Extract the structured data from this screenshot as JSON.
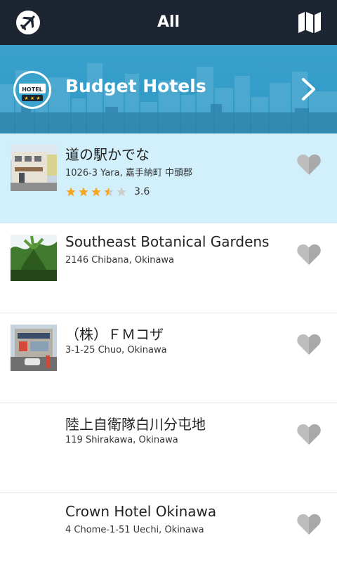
{
  "header": {
    "title": "All",
    "left_icon": "airplane-icon",
    "right_icon": "map-icon",
    "background": "#1d2432"
  },
  "banner": {
    "title": "Budget Hotels",
    "icon": "hotel-icon",
    "icon_text": "HOTEL",
    "chevron_icon": "chevron-right-icon",
    "background": "#3aa2cd"
  },
  "places": [
    {
      "name": "道の駅かでな",
      "address": "1026-3 Yara, 嘉手納町 中頭郡",
      "rating": 3.6,
      "rating_label": "3.6",
      "has_photo": true,
      "selected": true
    },
    {
      "name": "Southeast Botanical Gardens",
      "address": "2146 Chibana, Okinawa",
      "has_photo": true,
      "selected": false
    },
    {
      "name": "（株）ＦＭコザ",
      "address": "3-1-25 Chuo, Okinawa",
      "has_photo": true,
      "selected": false
    },
    {
      "name": "陸上自衛隊白川分屯地",
      "address": "119 Shirakawa, Okinawa",
      "has_photo": false,
      "selected": false
    },
    {
      "name": "Crown Hotel Okinawa",
      "address": "4 Chome-1-51 Uechi, Okinawa",
      "has_photo": false,
      "selected": false
    }
  ],
  "colors": {
    "selected_row": "#d1f0fb",
    "star_filled": "#f5a623",
    "star_empty": "#cccccc",
    "heart": "#bdbdbd"
  }
}
